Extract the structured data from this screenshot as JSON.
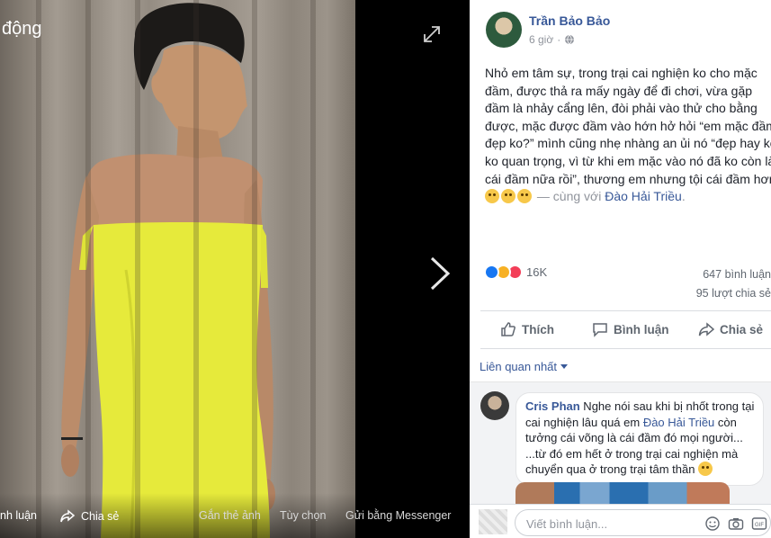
{
  "viewer": {
    "title": "động",
    "footer": {
      "comment": "nh luận",
      "share": "Chia sẻ",
      "tag": "Gắn thẻ ảnh",
      "options": "Tùy chọn",
      "send": "Gửi bằng Messenger"
    }
  },
  "post": {
    "author": "Trần Bảo Bảo",
    "time": "6 giờ",
    "text_lines": [
      "Nhỏ em tâm sự, trong trại cai nghiện ko cho mặc",
      "đầm, được thả ra mấy ngày để đi chơi, vừa gặp",
      "đầm là nhảy cẩng lên, đòi phải vào thử cho bằng",
      "được, mặc được đầm vào hớn hở hỏi “em mặc đầm",
      "đẹp ko?” mình cũng nhẹ nhàng an ủi nó “đẹp hay ko",
      "ko quan trọng, vì từ khi em mặc vào nó đã ko còn là",
      "cái đầm nữa rồi”, thương em nhưng tội cái đầm hơn"
    ],
    "with_text": " — cùng với ",
    "tagged": "Đào Hải Triều",
    "tagged_suffix": ".",
    "reaction_count": "16K",
    "comment_count": "647 bình luận",
    "share_count": "95 lượt chia sẻ"
  },
  "actions": {
    "like": "Thích",
    "comment": "Bình luận",
    "share": "Chia sẻ"
  },
  "comments": {
    "sort_label": "Liên quan nhất",
    "items": [
      {
        "name": "Cris Phan",
        "line1": " Nghe nói sau khi bị nhốt trong tại",
        "line2a": "cai nghiện lâu quá em ",
        "line2b": "Đào Hải Triều",
        "line2c": " còn",
        "line3": "tưởng cái võng là cái đầm đó mọi người...",
        "line4": "...từ đó em hết ở trong trại cai nghiện mà",
        "line5": "chuyển qua ở trong trại tâm thần "
      }
    ],
    "input_placeholder": "Viết bình luận..."
  },
  "colors": {
    "link": "#385898",
    "dress": "#e8ec3a",
    "like_blue": "#1877f2",
    "love_red": "#f33e58",
    "haha_yellow": "#f7b125"
  }
}
